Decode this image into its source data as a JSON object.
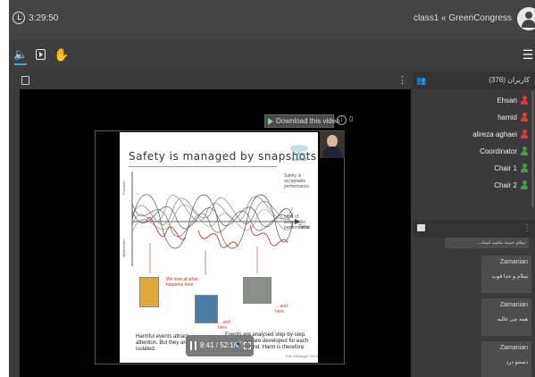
{
  "header": {
    "timer": "3:29:50",
    "class_title": "class1 « GreenCongress"
  },
  "toolbar": {
    "icons": [
      "speaker-icon",
      "player-icon",
      "hand-icon",
      "menu-icon"
    ]
  },
  "video": {
    "download_label": "Download this video",
    "download_count": "0",
    "info_label": "i",
    "time_readout": "8:41 / 52:16",
    "slide": {
      "title": "Safety is managed by snapshots",
      "logo_text": "Safety synesis",
      "time_axis": "Time",
      "note_ok": "Safety is acceptable performance",
      "note_marginal": "Limit of acceptable performance",
      "note_fail": "We look at what happens here",
      "note_and1": "... and here",
      "note_and2": "... and here",
      "caption_left": "Harmful events attract attention. But they are rare and isolated.",
      "caption_right": "Events are analysed step-by-step. Responses are developed for each problem found. Harm is therefore preventable.",
      "source": "Erik Hollnagel, 2013"
    }
  },
  "users": {
    "title": "کاربران (376)",
    "items": [
      {
        "name": "Ehsan",
        "color": "#e53935"
      },
      {
        "name": "hamid",
        "color": "#e53935"
      },
      {
        "name": "alireza aghaei",
        "color": "#e53935"
      },
      {
        "name": "Coordinator",
        "color": "#43a047"
      },
      {
        "name": "Chair 1",
        "color": "#43a047"
      },
      {
        "name": "Chair 2",
        "color": "#43a047"
      }
    ]
  },
  "chat": {
    "top_message": "...سلام خسته نباشید استاد",
    "messages": [
      {
        "sender": "Zamanian",
        "text": "سلام و خدا قوت"
      },
      {
        "sender": "Zamanian",
        "text": "همه چی عالیه"
      },
      {
        "sender": "Zamanian",
        "text": "دستتو درد"
      }
    ]
  },
  "colors": {
    "accent": "#4aa3df",
    "presenter_red": "#e53935",
    "attendee_green": "#43a047",
    "frame_green": "#3f6b2a"
  }
}
